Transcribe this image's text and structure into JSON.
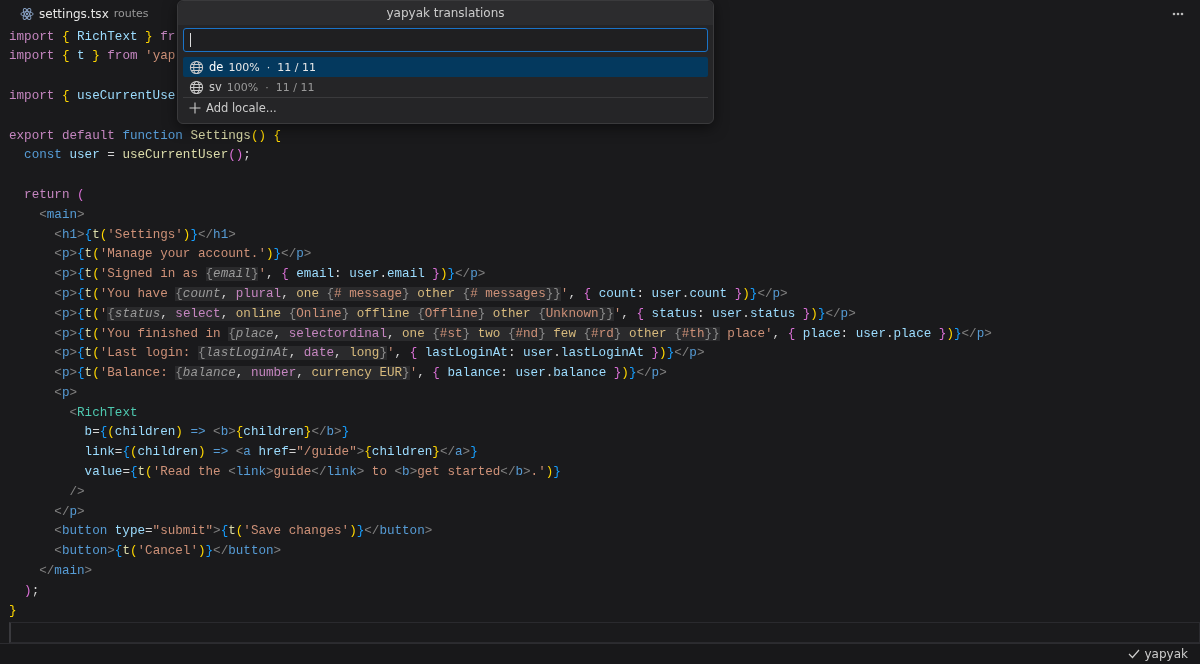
{
  "tab": {
    "file": "settings.tsx",
    "folder": "routes"
  },
  "code": [
    {
      "kind": "code",
      "tokens": [
        {
          "kind": "kw",
          "text": "import "
        },
        {
          "kind": "b1",
          "text": "{ "
        },
        {
          "kind": "var",
          "text": "RichText "
        },
        {
          "kind": "b1",
          "text": "} "
        },
        {
          "kind": "kw",
          "text": "fr"
        }
      ]
    },
    {
      "kind": "code",
      "tokens": [
        {
          "kind": "kw",
          "text": "import "
        },
        {
          "kind": "b1",
          "text": "{ "
        },
        {
          "kind": "var",
          "text": "t "
        },
        {
          "kind": "b1",
          "text": "} "
        },
        {
          "kind": "kw",
          "text": "from "
        },
        {
          "kind": "str",
          "text": "'yap"
        }
      ]
    },
    {
      "kind": "blank"
    },
    {
      "kind": "code",
      "tokens": [
        {
          "kind": "kw",
          "text": "import "
        },
        {
          "kind": "b1",
          "text": "{ "
        },
        {
          "kind": "var",
          "text": "useCurrentUse"
        }
      ]
    },
    {
      "kind": "blank"
    },
    {
      "kind": "code",
      "tokens": [
        {
          "kind": "kw",
          "text": "export default "
        },
        {
          "kind": "st",
          "text": "function "
        },
        {
          "kind": "fn",
          "text": "Settings"
        },
        {
          "kind": "b1",
          "text": "() {"
        }
      ]
    },
    {
      "kind": "code",
      "tokens": [
        {
          "kind": "st",
          "text": "  const "
        },
        {
          "kind": "var",
          "text": "user"
        },
        {
          "kind": "p",
          "text": " = "
        },
        {
          "kind": "fn",
          "text": "useCurrentUser"
        },
        {
          "kind": "b2",
          "text": "()"
        },
        {
          "kind": "p",
          "text": ";"
        }
      ]
    },
    {
      "kind": "blank"
    },
    {
      "kind": "code",
      "tokens": [
        {
          "kind": "kw",
          "text": "  return "
        },
        {
          "kind": "b2",
          "text": "("
        }
      ]
    },
    {
      "kind": "code",
      "tokens": [
        {
          "kind": "ang",
          "text": "    <"
        },
        {
          "kind": "tag",
          "text": "main"
        },
        {
          "kind": "ang",
          "text": ">"
        }
      ]
    },
    {
      "kind": "code",
      "tokens": [
        {
          "kind": "ang",
          "text": "      <"
        },
        {
          "kind": "tag",
          "text": "h1"
        },
        {
          "kind": "ang",
          "text": ">"
        },
        {
          "kind": "b3",
          "text": "{"
        },
        {
          "kind": "fn",
          "text": "t"
        },
        {
          "kind": "b1",
          "text": "("
        },
        {
          "kind": "str",
          "text": "'Settings'"
        },
        {
          "kind": "b1",
          "text": ")"
        },
        {
          "kind": "b3",
          "text": "}"
        },
        {
          "kind": "ang",
          "text": "</"
        },
        {
          "kind": "tag",
          "text": "h1"
        },
        {
          "kind": "ang",
          "text": ">"
        }
      ]
    },
    {
      "kind": "code",
      "tokens": [
        {
          "kind": "ang",
          "text": "      <"
        },
        {
          "kind": "tag",
          "text": "p"
        },
        {
          "kind": "ang",
          "text": ">"
        },
        {
          "kind": "b3",
          "text": "{"
        },
        {
          "kind": "fn",
          "text": "t"
        },
        {
          "kind": "b1",
          "text": "("
        },
        {
          "kind": "str",
          "text": "'Manage your account.'"
        },
        {
          "kind": "b1",
          "text": ")"
        },
        {
          "kind": "b3",
          "text": "}"
        },
        {
          "kind": "ang",
          "text": "</"
        },
        {
          "kind": "tag",
          "text": "p"
        },
        {
          "kind": "ang",
          "text": ">"
        }
      ]
    },
    {
      "kind": "code",
      "tokens": [
        {
          "kind": "ang",
          "text": "      <"
        },
        {
          "kind": "tag",
          "text": "p"
        },
        {
          "kind": "ang",
          "text": ">"
        },
        {
          "kind": "b3",
          "text": "{"
        },
        {
          "kind": "fn",
          "text": "t"
        },
        {
          "kind": "b1",
          "text": "("
        },
        {
          "kind": "str",
          "text": "'Signed in as "
        },
        {
          "kind": "ib",
          "text": "{"
        },
        {
          "kind": "iv",
          "text": "email"
        },
        {
          "kind": "ib",
          "text": "}"
        },
        {
          "kind": "str",
          "text": "'"
        },
        {
          "kind": "p",
          "text": ", "
        },
        {
          "kind": "b2",
          "text": "{ "
        },
        {
          "kind": "var",
          "text": "email"
        },
        {
          "kind": "p",
          "text": ": "
        },
        {
          "kind": "var",
          "text": "user"
        },
        {
          "kind": "p",
          "text": "."
        },
        {
          "kind": "var",
          "text": "email "
        },
        {
          "kind": "b2",
          "text": "}"
        },
        {
          "kind": "b1",
          "text": ")"
        },
        {
          "kind": "b3",
          "text": "}"
        },
        {
          "kind": "ang",
          "text": "</"
        },
        {
          "kind": "tag",
          "text": "p"
        },
        {
          "kind": "ang",
          "text": ">"
        }
      ]
    },
    {
      "kind": "code",
      "tokens": [
        {
          "kind": "ang",
          "text": "      <"
        },
        {
          "kind": "tag",
          "text": "p"
        },
        {
          "kind": "ang",
          "text": ">"
        },
        {
          "kind": "b3",
          "text": "{"
        },
        {
          "kind": "fn",
          "text": "t"
        },
        {
          "kind": "b1",
          "text": "("
        },
        {
          "kind": "str",
          "text": "'You have "
        },
        {
          "kind": "ib",
          "text": "{"
        },
        {
          "kind": "iv",
          "text": "count"
        },
        {
          "kind": "ip",
          "text": ", "
        },
        {
          "kind": "ik",
          "text": "plural"
        },
        {
          "kind": "ip",
          "text": ", "
        },
        {
          "kind": "ia",
          "text": "one "
        },
        {
          "kind": "ib",
          "text": "{"
        },
        {
          "kind": "it",
          "text": "# message"
        },
        {
          "kind": "ib",
          "text": "} "
        },
        {
          "kind": "ia",
          "text": "other "
        },
        {
          "kind": "ib",
          "text": "{"
        },
        {
          "kind": "it",
          "text": "# messages"
        },
        {
          "kind": "ib",
          "text": "}}"
        },
        {
          "kind": "str",
          "text": "'"
        },
        {
          "kind": "p",
          "text": ", "
        },
        {
          "kind": "b2",
          "text": "{ "
        },
        {
          "kind": "var",
          "text": "count"
        },
        {
          "kind": "p",
          "text": ": "
        },
        {
          "kind": "var",
          "text": "user"
        },
        {
          "kind": "p",
          "text": "."
        },
        {
          "kind": "var",
          "text": "count "
        },
        {
          "kind": "b2",
          "text": "}"
        },
        {
          "kind": "b1",
          "text": ")"
        },
        {
          "kind": "b3",
          "text": "}"
        },
        {
          "kind": "ang",
          "text": "</"
        },
        {
          "kind": "tag",
          "text": "p"
        },
        {
          "kind": "ang",
          "text": ">"
        }
      ]
    },
    {
      "kind": "code",
      "tokens": [
        {
          "kind": "ang",
          "text": "      <"
        },
        {
          "kind": "tag",
          "text": "p"
        },
        {
          "kind": "ang",
          "text": ">"
        },
        {
          "kind": "b3",
          "text": "{"
        },
        {
          "kind": "fn",
          "text": "t"
        },
        {
          "kind": "b1",
          "text": "("
        },
        {
          "kind": "str",
          "text": "'"
        },
        {
          "kind": "ib",
          "text": "{"
        },
        {
          "kind": "iv",
          "text": "status"
        },
        {
          "kind": "ip",
          "text": ", "
        },
        {
          "kind": "ik",
          "text": "select"
        },
        {
          "kind": "ip",
          "text": ", "
        },
        {
          "kind": "ia",
          "text": "online "
        },
        {
          "kind": "ib",
          "text": "{"
        },
        {
          "kind": "it",
          "text": "Online"
        },
        {
          "kind": "ib",
          "text": "} "
        },
        {
          "kind": "ia",
          "text": "offline "
        },
        {
          "kind": "ib",
          "text": "{"
        },
        {
          "kind": "it",
          "text": "Offline"
        },
        {
          "kind": "ib",
          "text": "} "
        },
        {
          "kind": "ia",
          "text": "other "
        },
        {
          "kind": "ib",
          "text": "{"
        },
        {
          "kind": "it",
          "text": "Unknown"
        },
        {
          "kind": "ib",
          "text": "}}"
        },
        {
          "kind": "str",
          "text": "'"
        },
        {
          "kind": "p",
          "text": ", "
        },
        {
          "kind": "b2",
          "text": "{ "
        },
        {
          "kind": "var",
          "text": "status"
        },
        {
          "kind": "p",
          "text": ": "
        },
        {
          "kind": "var",
          "text": "user"
        },
        {
          "kind": "p",
          "text": "."
        },
        {
          "kind": "var",
          "text": "status "
        },
        {
          "kind": "b2",
          "text": "}"
        },
        {
          "kind": "b1",
          "text": ")"
        },
        {
          "kind": "b3",
          "text": "}"
        },
        {
          "kind": "ang",
          "text": "</"
        },
        {
          "kind": "tag",
          "text": "p"
        },
        {
          "kind": "ang",
          "text": ">"
        }
      ]
    },
    {
      "kind": "code",
      "tokens": [
        {
          "kind": "ang",
          "text": "      <"
        },
        {
          "kind": "tag",
          "text": "p"
        },
        {
          "kind": "ang",
          "text": ">"
        },
        {
          "kind": "b3",
          "text": "{"
        },
        {
          "kind": "fn",
          "text": "t"
        },
        {
          "kind": "b1",
          "text": "("
        },
        {
          "kind": "str",
          "text": "'You finished in "
        },
        {
          "kind": "ib",
          "text": "{"
        },
        {
          "kind": "iv",
          "text": "place"
        },
        {
          "kind": "ip",
          "text": ", "
        },
        {
          "kind": "ik",
          "text": "selectordinal"
        },
        {
          "kind": "ip",
          "text": ", "
        },
        {
          "kind": "ia",
          "text": "one "
        },
        {
          "kind": "ib",
          "text": "{"
        },
        {
          "kind": "it",
          "text": "#st"
        },
        {
          "kind": "ib",
          "text": "} "
        },
        {
          "kind": "ia",
          "text": "two "
        },
        {
          "kind": "ib",
          "text": "{"
        },
        {
          "kind": "it",
          "text": "#nd"
        },
        {
          "kind": "ib",
          "text": "} "
        },
        {
          "kind": "ia",
          "text": "few "
        },
        {
          "kind": "ib",
          "text": "{"
        },
        {
          "kind": "it",
          "text": "#rd"
        },
        {
          "kind": "ib",
          "text": "} "
        },
        {
          "kind": "ia",
          "text": "other "
        },
        {
          "kind": "ib",
          "text": "{"
        },
        {
          "kind": "it",
          "text": "#th"
        },
        {
          "kind": "ib",
          "text": "}}"
        },
        {
          "kind": "str",
          "text": " place'"
        },
        {
          "kind": "p",
          "text": ", "
        },
        {
          "kind": "b2",
          "text": "{ "
        },
        {
          "kind": "var",
          "text": "place"
        },
        {
          "kind": "p",
          "text": ": "
        },
        {
          "kind": "var",
          "text": "user"
        },
        {
          "kind": "p",
          "text": "."
        },
        {
          "kind": "var",
          "text": "place "
        },
        {
          "kind": "b2",
          "text": "}"
        },
        {
          "kind": "b1",
          "text": ")"
        },
        {
          "kind": "b3",
          "text": "}"
        },
        {
          "kind": "ang",
          "text": "</"
        },
        {
          "kind": "tag",
          "text": "p"
        },
        {
          "kind": "ang",
          "text": ">"
        }
      ]
    },
    {
      "kind": "code",
      "tokens": [
        {
          "kind": "ang",
          "text": "      <"
        },
        {
          "kind": "tag",
          "text": "p"
        },
        {
          "kind": "ang",
          "text": ">"
        },
        {
          "kind": "b3",
          "text": "{"
        },
        {
          "kind": "fn",
          "text": "t"
        },
        {
          "kind": "b1",
          "text": "("
        },
        {
          "kind": "str",
          "text": "'Last login: "
        },
        {
          "kind": "ib",
          "text": "{"
        },
        {
          "kind": "iv",
          "text": "lastLoginAt"
        },
        {
          "kind": "ip",
          "text": ", "
        },
        {
          "kind": "ik",
          "text": "date"
        },
        {
          "kind": "ip",
          "text": ", "
        },
        {
          "kind": "ia",
          "text": "long"
        },
        {
          "kind": "ib",
          "text": "}"
        },
        {
          "kind": "str",
          "text": "'"
        },
        {
          "kind": "p",
          "text": ", "
        },
        {
          "kind": "b2",
          "text": "{ "
        },
        {
          "kind": "var",
          "text": "lastLoginAt"
        },
        {
          "kind": "p",
          "text": ": "
        },
        {
          "kind": "var",
          "text": "user"
        },
        {
          "kind": "p",
          "text": "."
        },
        {
          "kind": "var",
          "text": "lastLoginAt "
        },
        {
          "kind": "b2",
          "text": "}"
        },
        {
          "kind": "b1",
          "text": ")"
        },
        {
          "kind": "b3",
          "text": "}"
        },
        {
          "kind": "ang",
          "text": "</"
        },
        {
          "kind": "tag",
          "text": "p"
        },
        {
          "kind": "ang",
          "text": ">"
        }
      ]
    },
    {
      "kind": "code",
      "tokens": [
        {
          "kind": "ang",
          "text": "      <"
        },
        {
          "kind": "tag",
          "text": "p"
        },
        {
          "kind": "ang",
          "text": ">"
        },
        {
          "kind": "b3",
          "text": "{"
        },
        {
          "kind": "fn",
          "text": "t"
        },
        {
          "kind": "b1",
          "text": "("
        },
        {
          "kind": "str",
          "text": "'Balance: "
        },
        {
          "kind": "ib",
          "text": "{"
        },
        {
          "kind": "iv",
          "text": "balance"
        },
        {
          "kind": "ip",
          "text": ", "
        },
        {
          "kind": "ik",
          "text": "number"
        },
        {
          "kind": "ip",
          "text": ", "
        },
        {
          "kind": "ia",
          "text": "currency EUR"
        },
        {
          "kind": "ib",
          "text": "}"
        },
        {
          "kind": "str",
          "text": "'"
        },
        {
          "kind": "p",
          "text": ", "
        },
        {
          "kind": "b2",
          "text": "{ "
        },
        {
          "kind": "var",
          "text": "balance"
        },
        {
          "kind": "p",
          "text": ": "
        },
        {
          "kind": "var",
          "text": "user"
        },
        {
          "kind": "p",
          "text": "."
        },
        {
          "kind": "var",
          "text": "balance "
        },
        {
          "kind": "b2",
          "text": "}"
        },
        {
          "kind": "b1",
          "text": ")"
        },
        {
          "kind": "b3",
          "text": "}"
        },
        {
          "kind": "ang",
          "text": "</"
        },
        {
          "kind": "tag",
          "text": "p"
        },
        {
          "kind": "ang",
          "text": ">"
        }
      ]
    },
    {
      "kind": "code",
      "tokens": [
        {
          "kind": "ang",
          "text": "      <"
        },
        {
          "kind": "tag",
          "text": "p"
        },
        {
          "kind": "ang",
          "text": ">"
        }
      ]
    },
    {
      "kind": "code",
      "tokens": [
        {
          "kind": "ang",
          "text": "        <"
        },
        {
          "kind": "comp",
          "text": "RichText"
        }
      ]
    },
    {
      "kind": "code",
      "tokens": [
        {
          "kind": "var",
          "text": "          b"
        },
        {
          "kind": "p",
          "text": "="
        },
        {
          "kind": "b3",
          "text": "{"
        },
        {
          "kind": "b1",
          "text": "("
        },
        {
          "kind": "var",
          "text": "children"
        },
        {
          "kind": "b1",
          "text": ") "
        },
        {
          "kind": "st",
          "text": "=> "
        },
        {
          "kind": "ang",
          "text": "<"
        },
        {
          "kind": "tag",
          "text": "b"
        },
        {
          "kind": "ang",
          "text": ">"
        },
        {
          "kind": "b1",
          "text": "{"
        },
        {
          "kind": "var",
          "text": "children"
        },
        {
          "kind": "b1",
          "text": "}"
        },
        {
          "kind": "ang",
          "text": "</"
        },
        {
          "kind": "tag",
          "text": "b"
        },
        {
          "kind": "ang",
          "text": ">"
        },
        {
          "kind": "b3",
          "text": "}"
        }
      ]
    },
    {
      "kind": "code",
      "tokens": [
        {
          "kind": "var",
          "text": "          link"
        },
        {
          "kind": "p",
          "text": "="
        },
        {
          "kind": "b3",
          "text": "{"
        },
        {
          "kind": "b1",
          "text": "("
        },
        {
          "kind": "var",
          "text": "children"
        },
        {
          "kind": "b1",
          "text": ") "
        },
        {
          "kind": "st",
          "text": "=> "
        },
        {
          "kind": "ang",
          "text": "<"
        },
        {
          "kind": "tag",
          "text": "a "
        },
        {
          "kind": "var",
          "text": "href"
        },
        {
          "kind": "p",
          "text": "="
        },
        {
          "kind": "str",
          "text": "\"/guide\""
        },
        {
          "kind": "ang",
          "text": ">"
        },
        {
          "kind": "b1",
          "text": "{"
        },
        {
          "kind": "var",
          "text": "children"
        },
        {
          "kind": "b1",
          "text": "}"
        },
        {
          "kind": "ang",
          "text": "</"
        },
        {
          "kind": "tag",
          "text": "a"
        },
        {
          "kind": "ang",
          "text": ">"
        },
        {
          "kind": "b3",
          "text": "}"
        }
      ]
    },
    {
      "kind": "code",
      "tokens": [
        {
          "kind": "var",
          "text": "          value"
        },
        {
          "kind": "p",
          "text": "="
        },
        {
          "kind": "b3",
          "text": "{"
        },
        {
          "kind": "fn",
          "text": "t"
        },
        {
          "kind": "b1",
          "text": "("
        },
        {
          "kind": "str",
          "text": "'Read the "
        },
        {
          "kind": "ang",
          "text": "<"
        },
        {
          "kind": "tag",
          "text": "link"
        },
        {
          "kind": "ang",
          "text": ">"
        },
        {
          "kind": "str",
          "text": "guide"
        },
        {
          "kind": "ang",
          "text": "</"
        },
        {
          "kind": "tag",
          "text": "link"
        },
        {
          "kind": "ang",
          "text": ">"
        },
        {
          "kind": "str",
          "text": " to "
        },
        {
          "kind": "ang",
          "text": "<"
        },
        {
          "kind": "tag",
          "text": "b"
        },
        {
          "kind": "ang",
          "text": ">"
        },
        {
          "kind": "str",
          "text": "get started"
        },
        {
          "kind": "ang",
          "text": "</"
        },
        {
          "kind": "tag",
          "text": "b"
        },
        {
          "kind": "ang",
          "text": ">"
        },
        {
          "kind": "str",
          "text": ".'"
        },
        {
          "kind": "b1",
          "text": ")"
        },
        {
          "kind": "b3",
          "text": "}"
        }
      ]
    },
    {
      "kind": "code",
      "tokens": [
        {
          "kind": "ang",
          "text": "        />"
        }
      ]
    },
    {
      "kind": "code",
      "tokens": [
        {
          "kind": "ang",
          "text": "      </"
        },
        {
          "kind": "tag",
          "text": "p"
        },
        {
          "kind": "ang",
          "text": ">"
        }
      ]
    },
    {
      "kind": "code",
      "tokens": [
        {
          "kind": "ang",
          "text": "      <"
        },
        {
          "kind": "tag",
          "text": "button "
        },
        {
          "kind": "var",
          "text": "type"
        },
        {
          "kind": "p",
          "text": "="
        },
        {
          "kind": "str",
          "text": "\"submit\""
        },
        {
          "kind": "ang",
          "text": ">"
        },
        {
          "kind": "b3",
          "text": "{"
        },
        {
          "kind": "fn",
          "text": "t"
        },
        {
          "kind": "b1",
          "text": "("
        },
        {
          "kind": "str",
          "text": "'Save changes'"
        },
        {
          "kind": "b1",
          "text": ")"
        },
        {
          "kind": "b3",
          "text": "}"
        },
        {
          "kind": "ang",
          "text": "</"
        },
        {
          "kind": "tag",
          "text": "button"
        },
        {
          "kind": "ang",
          "text": ">"
        }
      ]
    },
    {
      "kind": "code",
      "tokens": [
        {
          "kind": "ang",
          "text": "      <"
        },
        {
          "kind": "tag",
          "text": "button"
        },
        {
          "kind": "ang",
          "text": ">"
        },
        {
          "kind": "b3",
          "text": "{"
        },
        {
          "kind": "fn",
          "text": "t"
        },
        {
          "kind": "b1",
          "text": "("
        },
        {
          "kind": "str",
          "text": "'Cancel'"
        },
        {
          "kind": "b1",
          "text": ")"
        },
        {
          "kind": "b3",
          "text": "}"
        },
        {
          "kind": "ang",
          "text": "</"
        },
        {
          "kind": "tag",
          "text": "button"
        },
        {
          "kind": "ang",
          "text": ">"
        }
      ]
    },
    {
      "kind": "code",
      "tokens": [
        {
          "kind": "ang",
          "text": "    </"
        },
        {
          "kind": "tag",
          "text": "main"
        },
        {
          "kind": "ang",
          "text": ">"
        }
      ]
    },
    {
      "kind": "code",
      "tokens": [
        {
          "kind": "b2",
          "text": "  )"
        },
        {
          "kind": "p",
          "text": ";"
        }
      ]
    },
    {
      "kind": "code",
      "tokens": [
        {
          "kind": "b1",
          "text": "}"
        }
      ]
    },
    {
      "kind": "current"
    }
  ],
  "palette": {
    "title": "yapyak translations",
    "items": [
      {
        "kind": "locale",
        "code": "de",
        "percent": "100%",
        "separator": "·",
        "count": "11 / 11",
        "selected": true
      },
      {
        "kind": "locale",
        "code": "sv",
        "percent": "100%",
        "separator": "·",
        "count": "11 / 11",
        "selected": false
      },
      {
        "kind": "action",
        "label": "Add locale...",
        "selected": false
      }
    ]
  },
  "status_bar": {
    "item": "yapyak"
  }
}
